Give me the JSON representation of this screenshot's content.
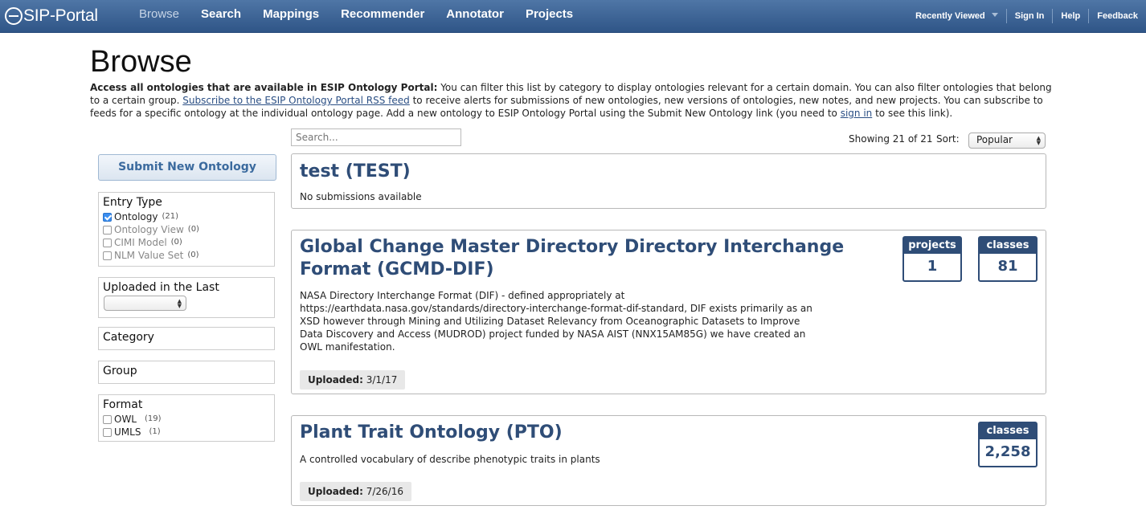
{
  "header": {
    "logo_text": "SIP-Portal",
    "nav": [
      "Browse",
      "Search",
      "Mappings",
      "Recommender",
      "Annotator",
      "Projects"
    ],
    "right": {
      "recent": "Recently Viewed",
      "signin": "Sign In",
      "help": "Help",
      "feedback": "Feedback"
    }
  },
  "page": {
    "title": "Browse",
    "intro_bold": "Access all ontologies that are available in ESIP Ontology Portal:",
    "intro_1": " You can filter this list by category to display ontologies relevant for a certain domain. You can also filter ontologies that belong to a certain group. ",
    "intro_link1": "Subscribe to the ESIP Ontology Portal RSS feed",
    "intro_2": " to receive alerts for submissions of new ontologies, new versions of ontologies, new notes, and new projects. You can subscribe to feeds for a specific ontology at the individual ontology page. Add a new ontology to ESIP Ontology Portal using the Submit New Ontology link (you need to ",
    "intro_link2": "sign in",
    "intro_3": " to see this link)."
  },
  "toolbar": {
    "search_placeholder": "Search...",
    "showing": "Showing 21 of 21",
    "sort_label": "Sort:",
    "sort_value": "Popular"
  },
  "sidebar": {
    "submit": "Submit New Ontology",
    "entry_type": {
      "title": "Entry Type",
      "options": [
        {
          "label": "Ontology",
          "count": "(21)"
        },
        {
          "label": "Ontology View",
          "count": "(0)"
        },
        {
          "label": "CIMI Model",
          "count": "(0)"
        },
        {
          "label": "NLM Value Set",
          "count": "(0)"
        }
      ]
    },
    "uploaded": {
      "title": "Uploaded in the Last"
    },
    "category": {
      "title": "Category"
    },
    "group": {
      "title": "Group"
    },
    "format": {
      "title": "Format",
      "options": [
        {
          "label": "OWL",
          "count": "(19)"
        },
        {
          "label": "UMLS",
          "count": "(1)"
        }
      ]
    }
  },
  "results": [
    {
      "title": "test (TEST)",
      "desc": "No submissions available"
    },
    {
      "title_l1": "Global Change Master Directory Directory Interchange",
      "title_l2": "Format (GCMD-DIF)",
      "desc": "NASA Directory Interchange Format (DIF) - defined appropriately at https://earthdata.nasa.gov/standards/directory-interchange-format-dif-standard, DIF exists primarily as an XSD however through Mining and Utilizing Dataset Relevancy from Oceanographic Datasets to Improve Data Discovery and Access (MUDROD) project funded by NASA AIST (NNX15AM85G) we have created an OWL manifestation.",
      "uploaded_label": "Uploaded:",
      "uploaded_date": "3/1/17",
      "metrics": [
        {
          "label": "projects",
          "value": "1"
        },
        {
          "label": "classes",
          "value": "81"
        }
      ]
    },
    {
      "title": "Plant Trait Ontology (PTO)",
      "desc": "A controlled vocabulary of describe phenotypic traits in plants",
      "uploaded_label": "Uploaded:",
      "uploaded_date": "7/26/16",
      "metrics": [
        {
          "label": "classes",
          "value": "2,258"
        }
      ]
    }
  ]
}
